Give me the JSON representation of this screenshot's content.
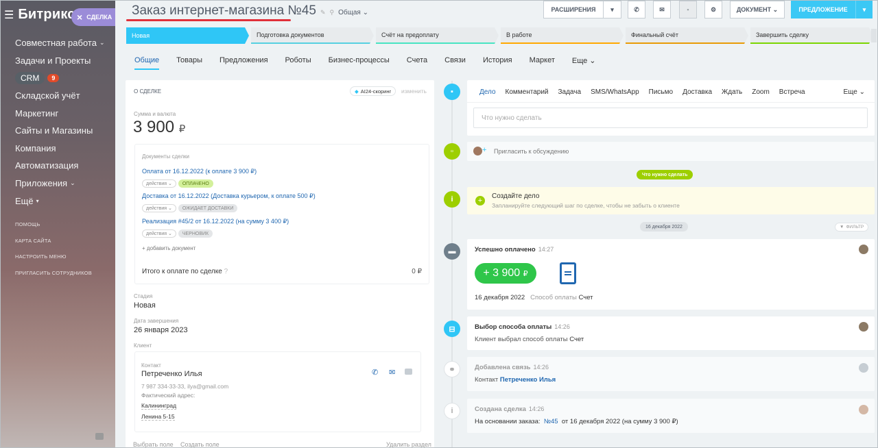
{
  "sidebar": {
    "brand": "Битрикс 24",
    "items": [
      "Совместная работа",
      "Задачи и Проекты",
      "CRM",
      "Складской учёт",
      "Маркетинг",
      "Сайты и Магазины",
      "Компания",
      "Автоматизация",
      "Приложения",
      "Ещё"
    ],
    "crm_count": "9",
    "small": [
      "ПОМОЩЬ",
      "КАРТА САЙТА",
      "НАСТРОИТЬ МЕНЮ",
      "ПРИГЛАСИТЬ СОТРУДНИКОВ"
    ]
  },
  "badge": {
    "label": "СДЕЛКА",
    "close": "×"
  },
  "header": {
    "title": "Заказ интернет-магазина №45",
    "category": "Общая"
  },
  "toolbar": {
    "extensions": "РАСШИРЕНИЯ",
    "document": "ДОКУМЕНТ",
    "offer": "ПРЕДЛОЖЕНИЕ"
  },
  "pipeline": [
    {
      "label": "Новая",
      "color": "#2fc6f6",
      "active": true
    },
    {
      "label": "Подготовка документов",
      "color": "#55d0e0"
    },
    {
      "label": "Счёт на предоплату",
      "color": "#47e4c2"
    },
    {
      "label": "В работе",
      "color": "#ffa900"
    },
    {
      "label": "Финальный счёт",
      "color": "#e89b06"
    },
    {
      "label": "Завершить сделку",
      "color": "#7bd500"
    }
  ],
  "tabs": [
    "Общие",
    "Товары",
    "Предложения",
    "Роботы",
    "Бизнес-процессы",
    "Счета",
    "Связи",
    "История",
    "Маркет",
    "Еще"
  ],
  "about": {
    "title": "О СДЕЛКЕ",
    "ai": "AI24-скоринг",
    "change": "изменить",
    "sum_label": "Сумма и валюта",
    "sum": "3 900",
    "currency": "₽"
  },
  "docs": {
    "title": "Документы сделки",
    "actions": "действия",
    "items": [
      {
        "text": "Оплата от 16.12.2022 (к оплате 3 900 ₽)",
        "status": "ОПЛАЧЕНО"
      },
      {
        "text": "Доставка от 16.12.2022 (Доставка курьером, к оплате 500 ₽)",
        "status": "ОЖИДАЕТ ДОСТАВКИ"
      },
      {
        "text": "Реализация #45/2 от 16.12.2022 (на сумму 3 400 ₽)",
        "status": "ЧЕРНОВИК"
      }
    ],
    "add": "+ добавить документ",
    "total_label": "Итого к оплате по сделке",
    "total": "0 ₽"
  },
  "fields": {
    "stage_label": "Стадия",
    "stage": "Новая",
    "date_label": "Дата завершения",
    "date": "26 января 2023",
    "client_label": "Клиент"
  },
  "contact": {
    "label": "Контакт",
    "name": "Петреченко Илья",
    "phone": "7 987 334-33-33, ilya@gmail.com",
    "addr_label": "Фактический адрес:",
    "city": "Калининград",
    "street": "Ленина 5-15"
  },
  "bottom": {
    "choose": "Выбрать поле",
    "create": "Создать поле",
    "delete": "Удалить раздел"
  },
  "activity": {
    "tabs": [
      "Дело",
      "Комментарий",
      "Задача",
      "SMS/WhatsApp",
      "Письмо",
      "Доставка",
      "Ждать",
      "Zoom",
      "Встреча",
      "Еще"
    ],
    "placeholder": "Что нужно сделать"
  },
  "invite": "Пригласить к обсуждению",
  "todo_chip": "Что нужно сделать",
  "create_task": {
    "title": "Создайте дело",
    "sub": "Запланируйте следующий шаг по сделке, чтобы не забыть о клиенте"
  },
  "date_chip": "16 декабря 2022",
  "filter": "ФИЛЬТР",
  "events": {
    "paid": {
      "title": "Успешно оплачено",
      "time": "14:27",
      "amount": "+ 3 900",
      "cur": "₽",
      "date": "16 декабря 2022",
      "method_label": "Способ оплаты",
      "method": "Счет"
    },
    "pay_method": {
      "title": "Выбор способа оплаты",
      "time": "14:26",
      "text": "Клиент выбрал способ оплаты",
      "value": "Счет"
    },
    "link": {
      "title": "Добавлена связь",
      "time": "14:26",
      "label": "Контакт",
      "value": "Петреченко Илья"
    },
    "created": {
      "title": "Создана сделка",
      "time": "14:26",
      "pre": "На основании заказа:",
      "num": "№45",
      "post": "от 16 декабря 2022 (на сумму 3 900 ₽)"
    }
  }
}
